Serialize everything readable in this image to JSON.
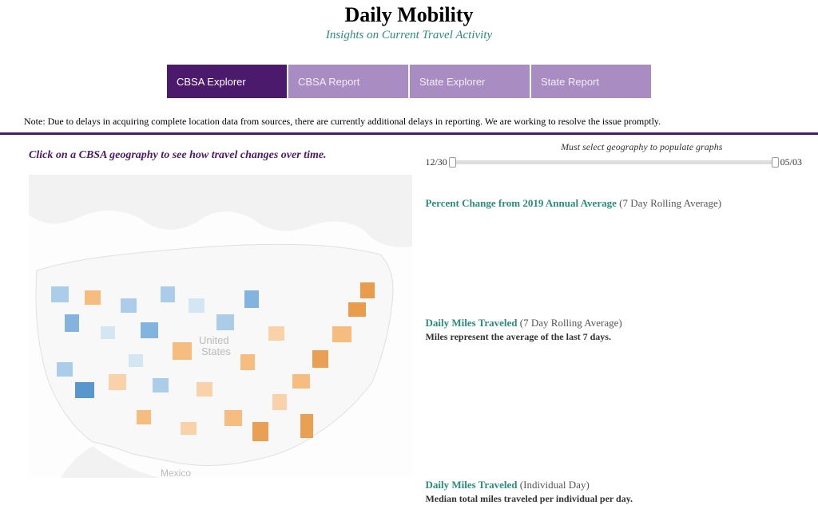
{
  "header": {
    "title": "Daily Mobility",
    "subtitle": "Insights on Current Travel Activity"
  },
  "tabs": [
    {
      "label": "CBSA Explorer",
      "active": true
    },
    {
      "label": "CBSA Report",
      "active": false
    },
    {
      "label": "State Explorer",
      "active": false
    },
    {
      "label": "State Report",
      "active": false
    }
  ],
  "note": "Note: Due to delays in acquiring complete location data from sources, there are currently additional delays in reporting. We are working to resolve the issue promptly.",
  "instruction": "Click on a CBSA geography to see how travel changes over time.",
  "slider": {
    "hint": "Must select geography to populate graphs",
    "start_label": "12/30",
    "end_label": "05/03"
  },
  "sections": {
    "percent_change": {
      "title_teal": "Percent Change from 2019 Annual Average",
      "title_gray": "(7 Day Rolling Average)"
    },
    "daily_miles_rolling": {
      "title_teal": "Daily Miles Traveled",
      "title_gray": "(7 Day Rolling Average)",
      "sub": "Miles represent the average of the last 7 days."
    },
    "daily_miles_individual": {
      "title_teal": "Daily Miles Traveled",
      "title_gray": "(Individual Day)",
      "sub": "Median total miles traveled per individual per day."
    }
  },
  "map": {
    "country_label": "United States",
    "mexico_label": "Mexico"
  }
}
